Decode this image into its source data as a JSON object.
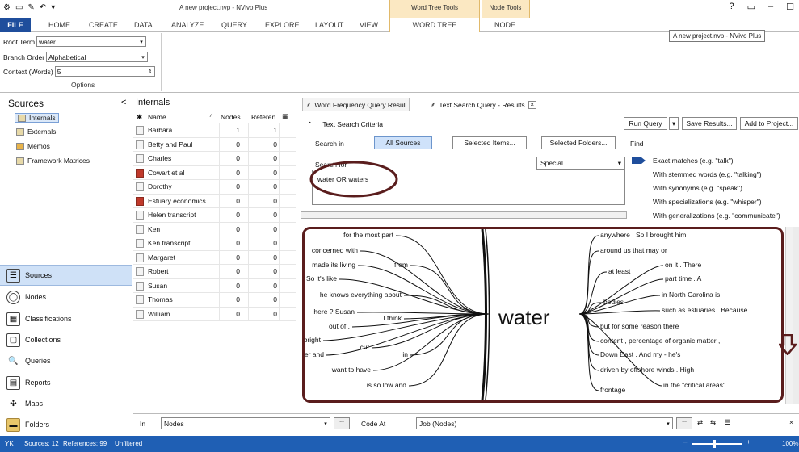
{
  "window": {
    "title": "A new project.nvp - NVivo Plus",
    "context_tabs": [
      "Word Tree Tools",
      "Node Tools"
    ],
    "tooltip": "A new project.nvp - NVivo Plus",
    "controls": [
      "?",
      "▭",
      "–",
      "☐"
    ]
  },
  "ribbon": {
    "file_label": "FILE",
    "tabs": [
      "HOME",
      "CREATE",
      "DATA",
      "ANALYZE",
      "QUERY",
      "EXPLORE",
      "LAYOUT",
      "VIEW",
      "WORD TREE",
      "NODE"
    ],
    "options": {
      "root_term_label": "Root Term",
      "root_term_value": "water",
      "branch_order_label": "Branch Order",
      "branch_order_value": "Alphabetical",
      "context_label": "Context (Words)",
      "context_value": "5",
      "group_label": "Options"
    }
  },
  "nav": {
    "header": "Sources",
    "collapse": "<",
    "tree_items": [
      "Internals",
      "Externals",
      "Memos",
      "Framework Matrices"
    ],
    "buttons": [
      {
        "label": "Sources",
        "icon": "sources-icon",
        "glyph": "☰"
      },
      {
        "label": "Nodes",
        "icon": "nodes-icon",
        "glyph": "◯"
      },
      {
        "label": "Classifications",
        "icon": "classifications-icon",
        "glyph": "▦"
      },
      {
        "label": "Collections",
        "icon": "collections-icon",
        "glyph": "▢"
      },
      {
        "label": "Queries",
        "icon": "queries-icon",
        "glyph": "🔍"
      },
      {
        "label": "Reports",
        "icon": "reports-icon",
        "glyph": "▤"
      },
      {
        "label": "Maps",
        "icon": "maps-icon",
        "glyph": "✣"
      },
      {
        "label": "Folders",
        "icon": "folders-icon",
        "glyph": "▬"
      }
    ]
  },
  "internals": {
    "title": "Internals",
    "columns": [
      "Name",
      "Nodes",
      "Referen"
    ],
    "rows": [
      {
        "name": "Barbara",
        "nodes": "1",
        "refs": "1",
        "pdf": false
      },
      {
        "name": "Betty and Paul",
        "nodes": "0",
        "refs": "0",
        "pdf": false
      },
      {
        "name": "Charles",
        "nodes": "0",
        "refs": "0",
        "pdf": false
      },
      {
        "name": "Cowart et al",
        "nodes": "0",
        "refs": "0",
        "pdf": true
      },
      {
        "name": "Dorothy",
        "nodes": "0",
        "refs": "0",
        "pdf": false
      },
      {
        "name": "Estuary economics",
        "nodes": "0",
        "refs": "0",
        "pdf": true
      },
      {
        "name": "Helen transcript",
        "nodes": "0",
        "refs": "0",
        "pdf": false
      },
      {
        "name": "Ken",
        "nodes": "0",
        "refs": "0",
        "pdf": false
      },
      {
        "name": "Ken transcript",
        "nodes": "0",
        "refs": "0",
        "pdf": false
      },
      {
        "name": "Margaret",
        "nodes": "0",
        "refs": "0",
        "pdf": false
      },
      {
        "name": "Robert",
        "nodes": "0",
        "refs": "0",
        "pdf": false
      },
      {
        "name": "Susan",
        "nodes": "0",
        "refs": "0",
        "pdf": false
      },
      {
        "name": "Thomas",
        "nodes": "0",
        "refs": "0",
        "pdf": false
      },
      {
        "name": "William",
        "nodes": "0",
        "refs": "0",
        "pdf": false
      }
    ]
  },
  "detail": {
    "tabs": [
      "Word Frequency Query Resul",
      "Text Search Query - Results"
    ],
    "run_query": "Run Query",
    "save_results": "Save Results...",
    "add_to_project": "Add to Project...",
    "criteria_header": "Text Search Criteria",
    "search_in_label": "Search in",
    "search_in_options": [
      "All Sources",
      "Selected Items...",
      "Selected Folders..."
    ],
    "find_label": "Find",
    "search_for_label": "Search for",
    "search_for_value": "water OR waters",
    "special_label": "Special",
    "find_options": [
      "Exact matches (e.g. \"talk\")",
      "With stemmed words (e.g. \"talking\")",
      "With synonyms (e.g. \"speak\")",
      "With specializations (e.g. \"whisper\")",
      "With generalizations (e.g. \"communicate\")"
    ]
  },
  "word_tree": {
    "root": "water",
    "left_phrases": [
      "for the most part",
      "concerned with",
      "made its living",
      "from",
      "So it's like",
      "he knows everything about",
      "here ? Susan",
      "I think",
      "out of .",
      "bright",
      "cut",
      "er and",
      "in",
      "want to have",
      "is so low and"
    ],
    "right_phrases": [
      "anywhere . So I brought him",
      "around us that may or",
      "at least",
      "on it . There",
      "part time . A",
      "bodies",
      "in North Carolina is",
      "such as estuaries . Because",
      "but for some reason there",
      "content , percentage of organic matter ,",
      "Down East . And my - he's",
      "driven by offshore winds . High",
      "frontage",
      "in the \"critical areas\""
    ]
  },
  "find_bar": {
    "in_label": "In",
    "in_value": "Nodes",
    "code_at_label": "Code At",
    "code_at_value": "Job (Nodes)",
    "browse": "..."
  },
  "status": {
    "user": "YK",
    "sources": "Sources: 12",
    "references": "References: 99",
    "filter": "Unfiltered",
    "zoom": "100%"
  },
  "colors": {
    "file_tab": "#1f4e9c",
    "context_tab": "#fbe8c2",
    "status_bar": "#1f5fb4",
    "annotation": "#5a1d1d"
  }
}
